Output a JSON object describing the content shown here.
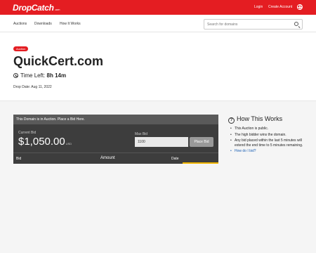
{
  "header": {
    "logo": "DropCatch",
    "logo_suffix": ".com",
    "login": "Login",
    "create_account": "Create Account"
  },
  "nav": {
    "items": [
      "Auctions",
      "Downloads",
      "How It Works"
    ],
    "search_placeholder": "Search for domains"
  },
  "auction": {
    "badge": "Auction",
    "domain": "QuickCert.com",
    "time_left_label": "Time Left:",
    "time_left_value": "8h 14m",
    "drop_date": "Drop Date: Aug 11, 2022"
  },
  "bid_panel": {
    "status": "This Domain is in Auction. Place a Bid Here.",
    "current_bid_label": "Current Bid",
    "current_bid": "$1,050.00",
    "currency": "USD",
    "max_bid_label": "Max Bid",
    "max_bid_value": "1100",
    "place_bid": "Place Bid",
    "columns": [
      "Bid",
      "Amount",
      "Date"
    ]
  },
  "how_it_works": {
    "title": "How This Works",
    "bullets": [
      "This Auction is public.",
      "The high bidder wins the domain.",
      "Any bid placed within the last 5 minutes will extend the end time to 5 minutes remaining."
    ],
    "link": "How do I bid?"
  },
  "colors": {
    "brand": "#e41d22",
    "accent_bar": "#f0b400"
  }
}
